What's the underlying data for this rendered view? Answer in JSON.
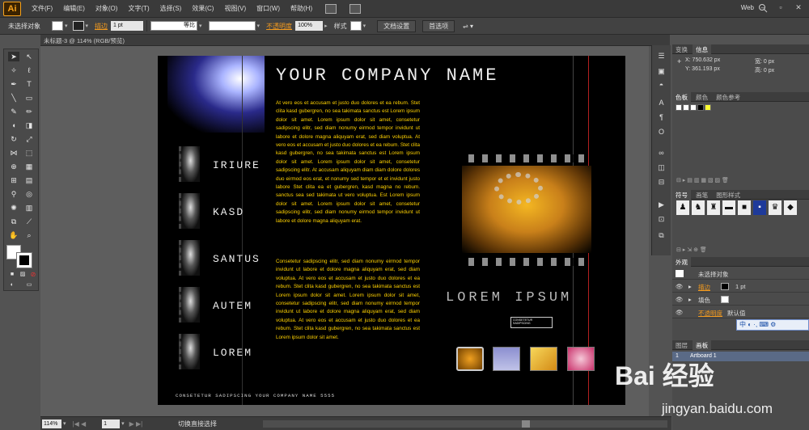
{
  "menubar": {
    "logo": "Ai",
    "items": [
      "文件(F)",
      "编辑(E)",
      "对象(O)",
      "文字(T)",
      "选择(S)",
      "效果(C)",
      "视图(V)",
      "窗口(W)",
      "帮助(H)"
    ],
    "workspace": "Web"
  },
  "controlbar": {
    "selection": "未选择对象",
    "stroke_label": "描边",
    "stroke_value": "1 pt",
    "profile_label": "等比",
    "opacity_label": "不透明度",
    "opacity_value": "100%",
    "style_label": "样式",
    "doc_setup": "文档设置",
    "preferences": "首选项"
  },
  "doc_tab": "未标题-3 @ 114% (RGB/预览)",
  "artwork": {
    "company_name": "YOUR COMPANY NAME",
    "menu": [
      "IRIURE",
      "KASD",
      "SANTUS",
      "AUTEM",
      "LOREM"
    ],
    "paragraph1": "At vero eos et accusam et justo duo dolores et ea rebum. Stet clita kasd gubergren, no sea takimata sanctus est Lorem ipsum dolor sit amet. Lorem ipsum dolor sit amet, consetetur sadipscing elitr, sed diam nonumy eirmod tempor invidunt ut labore et dolore magna aliquyam erat, sed diam voluptua. At vero eos et accusam et justo duo dolores et ea rebum. Stet clita kasd gubergren, no sea takimata sanctus est Lorem ipsum dolor sit amet. Lorem ipsum dolor sit amet, consetetur sadipscing elitr. At accusam aliquyam diam diam dolore dolores duo eirmod eos erat, et nonumy sed tempor et et invidunt justo labore Stet clita ea et gubergren, kasd magna no rebum. sanctus sea sed takimata ut vero voluptua. Est Lorem ipsum dolor sit amet. Lorem ipsum dolor sit amet, consetetur sadipscing elitr, sed diam nonumy eirmod tempor invidunt ut labore et dolore magna aliquyam erat.",
    "paragraph2": "Consetetur sadipscing elitr, sed diam nonumy eirmod tempor invidunt ut labore et dolore magna aliquyam erat, sed diam voluptua. At vero eos et accusam et justo duo dolores et ea rebum. Stet clita kasd gubergren, no sea takimata sanctus est Lorem ipsum dolor sit amet. Lorem ipsum dolor sit amet, consetetur sadipscing elitr, sed diam nonumy eirmod tempor invidunt ut labore et dolore magna aliquyam erat, sed diam voluptua. At vero eos et accusam et justo duo dolores et ea rebum. Stet clita kasd gubergren, no sea takimata sanctus est Lorem ipsum dolor sit amet.",
    "lorem_ipsum": "LOREM IPSUM",
    "small_logo": "CONSETETUR SADIPSCING",
    "footer": "CONSETETUR SADIPSCING YOUR COMPANY NAME 5555"
  },
  "statusbar": {
    "zoom": "114%",
    "page": "1",
    "status": "切换直接选择"
  },
  "panels": {
    "info_tabs": [
      "变换",
      "信息"
    ],
    "x": "X: 750.632 px",
    "y": "Y: 361.193 px",
    "w": "宽: 0 px",
    "h": "高: 0 px",
    "color_tabs": [
      "色板",
      "颜色",
      "颜色参考"
    ],
    "symbol_tabs": [
      "符号",
      "画笔",
      "图形样式"
    ],
    "appearance_title": "外观",
    "appearance_none": "未选择对象",
    "appearance_stroke": "描边",
    "appearance_stroke_val": "1 pt",
    "appearance_fill": "填色",
    "appearance_opacity": "不透明度",
    "appearance_opacity_val": "默认值",
    "layers_tabs": [
      "图层",
      "画板"
    ],
    "artboard_item": "Artboard 1",
    "artboard_num": "1"
  },
  "ime": "中",
  "watermark": {
    "brand": "Bai 经验",
    "url": "jingyan.baidu.com"
  },
  "colors": {
    "accent_orange": "#f39a1e",
    "body_yellow": "#ffd200",
    "swatch_yellow": "#ffff33"
  }
}
